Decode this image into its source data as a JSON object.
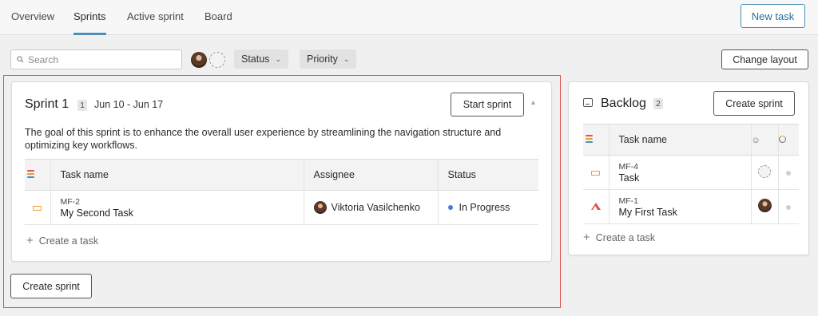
{
  "nav": {
    "tabs": [
      "Overview",
      "Sprints",
      "Active sprint",
      "Board"
    ],
    "active_tab": "Sprints",
    "new_task_label": "New task"
  },
  "toolbar": {
    "search_placeholder": "Search",
    "filters": [
      "Status",
      "Priority"
    ],
    "change_layout_label": "Change layout"
  },
  "sprint": {
    "title": "Sprint 1",
    "task_count": "1",
    "dates": "Jun 10 - Jun 17",
    "start_label": "Start sprint",
    "goal": "The goal of this sprint is to enhance the overall user experience by streamlining the navigation structure and optimizing key workflows.",
    "columns": [
      "Task name",
      "Assignee",
      "Status"
    ],
    "tasks": [
      {
        "key": "MF-2",
        "name": "My Second Task",
        "assignee": "Viktoria Vasilchenko",
        "status": "In Progress",
        "priority_icon": "medium-priority-icon"
      }
    ],
    "create_task_label": "Create a task"
  },
  "create_sprint_label": "Create sprint",
  "backlog": {
    "title": "Backlog",
    "task_count": "2",
    "create_sprint_label": "Create sprint",
    "columns": [
      "Task name"
    ],
    "tasks": [
      {
        "key": "MF-4",
        "name": "Task",
        "priority_icon": "medium-priority-icon",
        "assignee_icon": "unassigned-avatar-icon"
      },
      {
        "key": "MF-1",
        "name": "My First Task",
        "priority_icon": "high-priority-icon",
        "assignee_icon": "avatar"
      }
    ],
    "create_task_label": "Create a task"
  },
  "colors": {
    "accent": "#4d8fb8",
    "highlight": "#d9534f",
    "in_progress": "#3f7fe0",
    "priority_medium": "#e8a02b",
    "priority_high": "#e35050"
  }
}
